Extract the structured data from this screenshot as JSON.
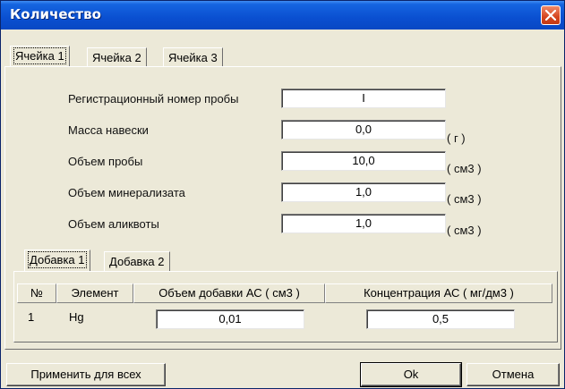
{
  "window": {
    "title": "Количество",
    "close_icon": "close-icon"
  },
  "cell_tabs": [
    {
      "label": "Ячейка 1",
      "active": true
    },
    {
      "label": "Ячейка 2",
      "active": false
    },
    {
      "label": "Ячейка 3",
      "active": false
    }
  ],
  "fields": [
    {
      "label": "Регистрационный номер пробы",
      "value": "I",
      "unit": ""
    },
    {
      "label": "Масса навески",
      "value": "0,0",
      "unit": "( г )"
    },
    {
      "label": "Объем пробы",
      "value": "10,0",
      "unit": "( см3 )"
    },
    {
      "label": "Объем минерализата",
      "value": "1,0",
      "unit": "( см3 )"
    },
    {
      "label": "Объем аликвоты",
      "value": "1,0",
      "unit": "( см3 )"
    }
  ],
  "additive_tabs": [
    {
      "label": "Добавка 1",
      "active": true
    },
    {
      "label": "Добавка 2",
      "active": false
    }
  ],
  "table": {
    "headers": [
      "№",
      "Элемент",
      "Объем добавки АС ( см3 )",
      "Концентрация АС ( мг/дм3 )"
    ],
    "rows": [
      {
        "num": "1",
        "element": "Hg",
        "volume": "0,01",
        "concentration": "0,5"
      }
    ]
  },
  "buttons": {
    "apply_all": "Применить для всех",
    "ok": "Ok",
    "cancel": "Отмена"
  }
}
